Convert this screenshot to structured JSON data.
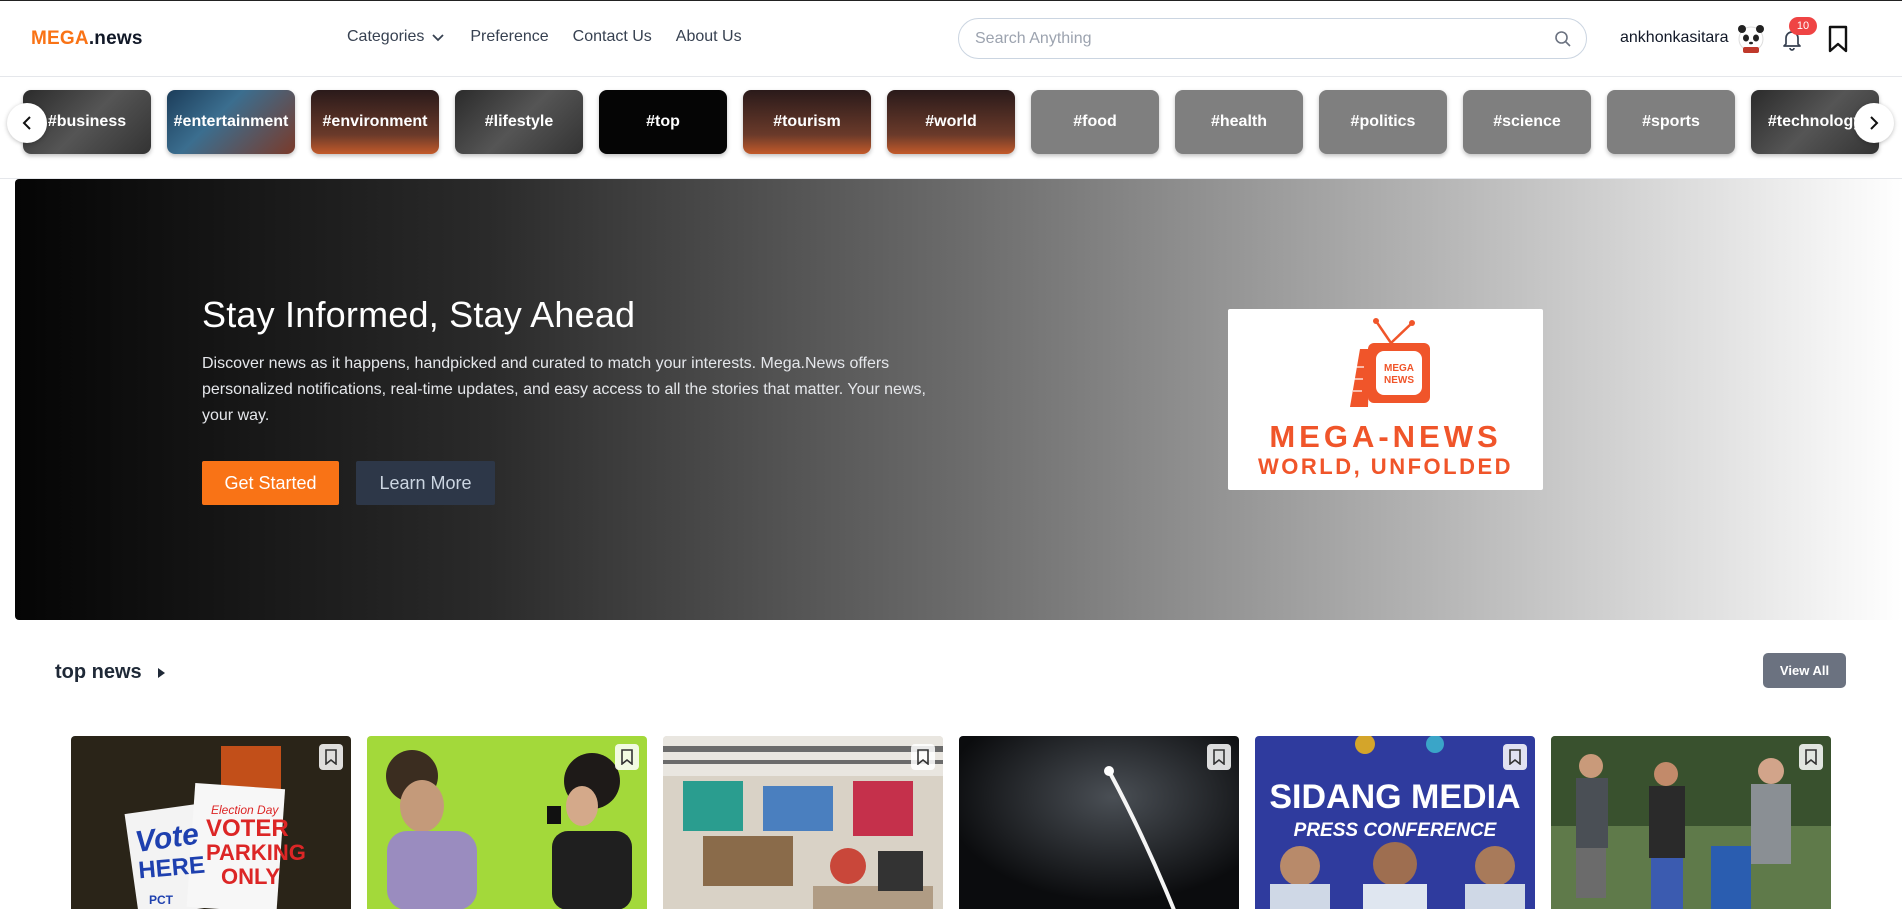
{
  "header": {
    "logo_mega": "MEGA",
    "logo_news": ".news",
    "nav": [
      {
        "label": "Categories",
        "has_dropdown": true
      },
      {
        "label": "Preference"
      },
      {
        "label": "Contact Us"
      },
      {
        "label": "About Us"
      }
    ],
    "search_placeholder": "Search Anything",
    "username": "ankhonkasitara",
    "notification_count": "10"
  },
  "tags": [
    {
      "label": "#business",
      "style": "dark"
    },
    {
      "label": "#entertainment",
      "style": "photo1"
    },
    {
      "label": "#environment",
      "style": "photo2"
    },
    {
      "label": "#lifestyle",
      "style": "dark"
    },
    {
      "label": "#top",
      "style": "black"
    },
    {
      "label": "#tourism",
      "style": "photo2"
    },
    {
      "label": "#world",
      "style": "photo2"
    },
    {
      "label": "#food",
      "style": "grey"
    },
    {
      "label": "#health",
      "style": "grey"
    },
    {
      "label": "#politics",
      "style": "grey"
    },
    {
      "label": "#science",
      "style": "grey"
    },
    {
      "label": "#sports",
      "style": "grey"
    },
    {
      "label": "#technology",
      "style": "dark"
    }
  ],
  "hero": {
    "title": "Stay Informed, Stay Ahead",
    "description": "Discover news as it happens, handpicked and curated to match your interests. Mega.News offers personalized notifications, real-time updates, and easy access to all the stories that matter. Your news, your way.",
    "primary_button": "Get Started",
    "secondary_button": "Learn More",
    "logo_badge_line1": "MEGA",
    "logo_badge_line2": "NEWS",
    "logo_line1": "MEGA-NEWS",
    "logo_line2": "WORLD, UNFOLDED"
  },
  "section": {
    "title": "top news",
    "view_all": "View All"
  },
  "cards": [
    {
      "name": "vote-here",
      "texts": [
        "Vote",
        "HERE",
        "Election Day",
        "VOTER",
        "PARKING",
        "ONLY",
        "PCT"
      ]
    },
    {
      "name": "concert",
      "texts": []
    },
    {
      "name": "library",
      "texts": []
    },
    {
      "name": "missile-launch",
      "texts": []
    },
    {
      "name": "press-conference",
      "texts": [
        "SIDANG MEDIA",
        "PRESS CONFERENCE"
      ]
    },
    {
      "name": "golf",
      "texts": []
    }
  ],
  "colors": {
    "brand_orange": "#f97316",
    "notification_red": "#ef4444",
    "dark_button": "#2d3748",
    "view_all_grey": "#6b7280"
  }
}
